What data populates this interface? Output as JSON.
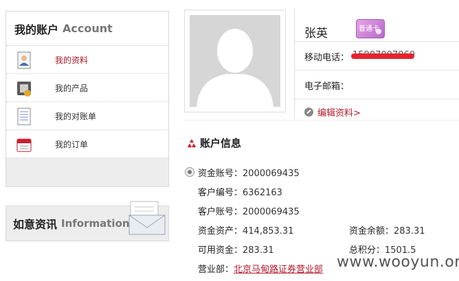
{
  "left_panel": {
    "title_cn": "我的账户",
    "title_en": "Account",
    "menu": [
      {
        "label": "我的资料",
        "icon": "profile-icon",
        "active": true
      },
      {
        "label": "我的产品",
        "icon": "product-icon",
        "active": false
      },
      {
        "label": "我的对账单",
        "icon": "statement-icon",
        "active": false
      },
      {
        "label": "我的订单",
        "icon": "order-icon",
        "active": false
      }
    ]
  },
  "info_panel": {
    "title_cn": "如意资讯",
    "title_en": "Information"
  },
  "profile": {
    "name": "张英",
    "card_label": "普通卡",
    "phone_label": "移动电话：",
    "phone_value": "15907007060",
    "email_label": "电子邮箱：",
    "email_value": "",
    "edit_label": "编辑资料>"
  },
  "account_info": {
    "title": "账户信息",
    "fund_account_label": "资金账号：",
    "fund_account_value": "2000069435",
    "customer_no_label": "客户编号：",
    "customer_no_value": "6362163",
    "customer_account_label": "客户账号：",
    "customer_account_value": "2000069435",
    "fund_assets_label": "资金资产：",
    "fund_assets_value": "414,853.31",
    "fund_balance_label": "资金余额：",
    "fund_balance_value": "283.31",
    "available_label": "可用资金：",
    "available_value": "283.31",
    "total_points_label": "总积分：",
    "total_points_value": "1501.5",
    "branch_label": "营业部：",
    "branch_value": "北京马甸路证券营业部"
  },
  "watermark": "www.wooyun.org",
  "colors": {
    "accent": "#b2182b",
    "panel_bg": "#ededed",
    "border": "#d8d8d8"
  }
}
